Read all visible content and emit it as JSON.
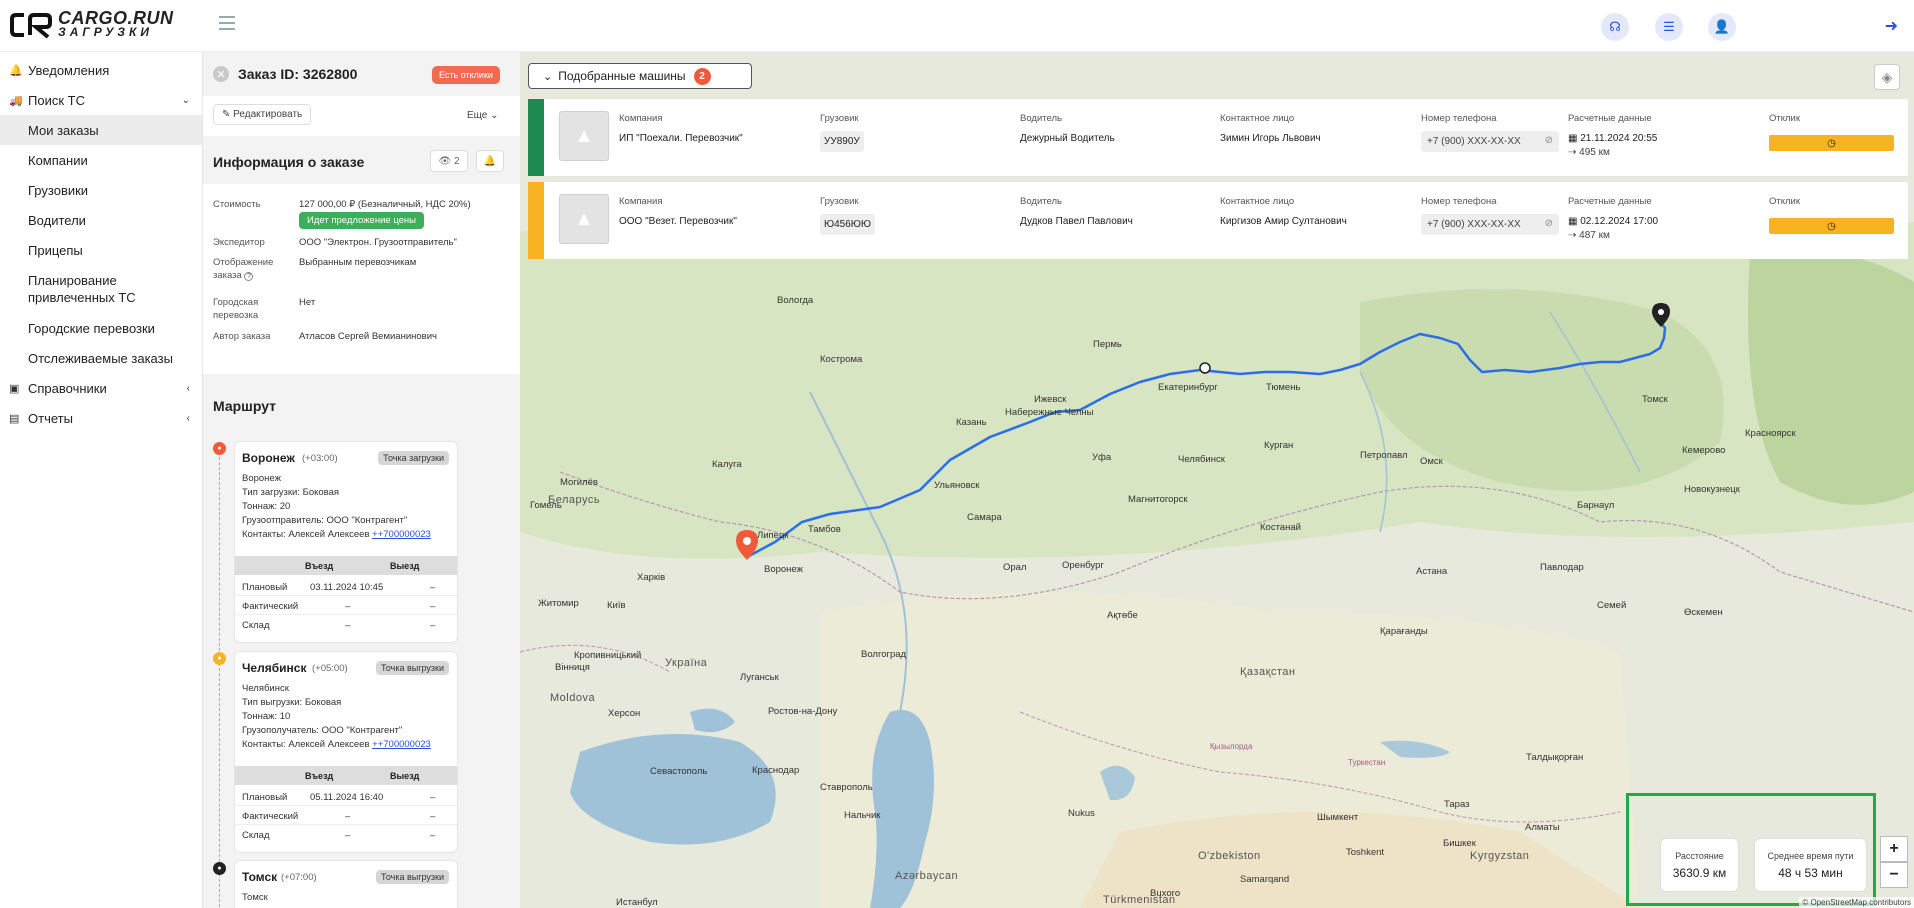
{
  "logo": {
    "main": "CARGO.RUN",
    "sub": "ЗАГРУЗКИ"
  },
  "header": {
    "icons": [
      "headset-icon",
      "list-icon",
      "user-settings-icon"
    ],
    "logout_icon": "logout-icon"
  },
  "sidebar": {
    "items": [
      {
        "label": "Уведомления",
        "icon": "bell-icon"
      },
      {
        "label": "Поиск ТС",
        "icon": "truck-icon"
      },
      {
        "label": "Мои заказы"
      },
      {
        "label": "Компании"
      },
      {
        "label": "Грузовики"
      },
      {
        "label": "Водители"
      },
      {
        "label": "Прицепы"
      },
      {
        "label": "Планирование привлеченных ТС"
      },
      {
        "label": "Городские перевозки"
      },
      {
        "label": "Отслеживаемые заказы"
      },
      {
        "label": "Справочники",
        "icon": "book-icon"
      },
      {
        "label": "Отчеты",
        "icon": "report-icon"
      }
    ]
  },
  "order": {
    "title": "Заказ ID: 3262800",
    "badge": "Есть отклики",
    "edit": "Редактировать",
    "more": "Еще",
    "info_title": "Информация о заказе",
    "views": "2",
    "cost_label": "Стоимость",
    "cost_value": "127 000,00 ₽ (Безналичный, НДС 20%)",
    "price_status": "Идет предложение цены",
    "forwarder_label": "Экспедитор",
    "forwarder_value": "ООО \"Электрон. Грузоотправитель\"",
    "display_label": "Отображение заказа",
    "display_value": "Выбранным перевозчикам",
    "city_label": "Городская перевозка",
    "city_value": "Нет",
    "author_label": "Автор заказа",
    "author_value": "Атласов Сергей Вемианинович"
  },
  "route": {
    "title": "Маршрут",
    "col_entry": "Въезд",
    "col_exit": "Выезд",
    "row_plan": "Плановый",
    "row_fact": "Фактический",
    "row_store": "Склад",
    "dash": "–",
    "points": [
      {
        "city": "Воронеж",
        "tz": "(+03:00)",
        "tag": "Точка загрузки",
        "sub": "Воронеж",
        "type": "Тип загрузки: Боковая",
        "tonnage": "Тоннаж: 20",
        "party": "Грузоотправитель: ООО \"Контрагент\"",
        "contacts": "Контакты: Алексей Алексеев",
        "phone": "++700000023",
        "plan": "03.11.2024 10:45",
        "color": "#f05a3b"
      },
      {
        "city": "Челябинск",
        "tz": "(+05:00)",
        "tag": "Точка выгрузки",
        "sub": "Челябинск",
        "type": "Тип выгрузки: Боковая",
        "tonnage": "Тоннаж: 10",
        "party": "Грузополучатель: ООО \"Контрагент\"",
        "contacts": "Контакты: Алексей Алексеев",
        "phone": "++700000023",
        "plan": "05.11.2024 16:40",
        "color": "#f7b321"
      },
      {
        "city": "Томск",
        "tz": "(+07:00)",
        "tag": "Точка выгрузки",
        "sub": "Томск",
        "color": "#222222"
      }
    ]
  },
  "map": {
    "machines_label": "Подобранные машины",
    "machines_count": "2",
    "columns": [
      "Компания",
      "Грузовик",
      "Водитель",
      "Контактное лицо",
      "Номер телефона",
      "Расчетные данные",
      "Отклик"
    ],
    "carriers": [
      {
        "company": "ИП \"Поехали. Перевозчик\"",
        "truck": "УУ890У",
        "driver": "Дежурный Водитель",
        "contact": "Зимин Игорь Львович",
        "phone": "+7 (900) XXX-XX-XX",
        "date": "21.11.2024 20:55",
        "distance": "495 км",
        "stripe": "#1f8a4f"
      },
      {
        "company": "ООО \"Везет. Перевозчик\"",
        "truck": "Ю456ЮЮ",
        "driver": "Дудков Павел Павлович",
        "contact": "Киргизов Амир Султанович",
        "phone": "+7 (900) XXX-XX-XX",
        "date": "02.12.2024 17:00",
        "distance": "487 км",
        "stripe": "#f7b321"
      }
    ],
    "cities": [
      "Вологда",
      "Кострома",
      "Пермь",
      "Екатеринбург",
      "Тюмень",
      "Томск",
      "Красноярск",
      "Кемерово",
      "Новокузнецк",
      "Барнаул",
      "Омск",
      "Петропавл",
      "Курган",
      "Челябинск",
      "Магнитогорск",
      "Уфа",
      "Ижевск",
      "Набережные Челны",
      "Казань",
      "Ульяновск",
      "Самара",
      "Калуга",
      "Тамбов",
      "Воронеж",
      "Липецк",
      "Оренбург",
      "Орал",
      "Костанай",
      "Астана",
      "Павлодар",
      "Семей",
      "Өскемен",
      "Қарағанды",
      "Ақтөбе",
      "Волгоград",
      "Харків",
      "Київ",
      "Житомир",
      "Вінниця",
      "Кропивницький",
      "Херсон",
      "Ростов-на-Дону",
      "Луганськ",
      "Севастополь",
      "Краснодар",
      "Ставрополь",
      "Нальчик",
      "Шымкент",
      "Бишкек",
      "Алматы",
      "Samarqand",
      "Buxoro",
      "Nukus",
      "Toshkent",
      "Могилёв",
      "Гомель",
      "Moldova",
      "Україна",
      "Беларусь",
      "Қазақстан",
      "O'zbekiston",
      "Kyrgyzstan",
      "Türkmenistan",
      "Azərbaycan",
      "Истанбул",
      "Қызылорда",
      "Туркестан",
      "Тараз",
      "Талдықорған"
    ],
    "distance_label": "Расстояние",
    "distance_value": "3630.9 км",
    "time_label": "Среднее время пути",
    "time_value": "48 ч 53 мин",
    "attribution": "© OpenStreetMap contributors"
  }
}
